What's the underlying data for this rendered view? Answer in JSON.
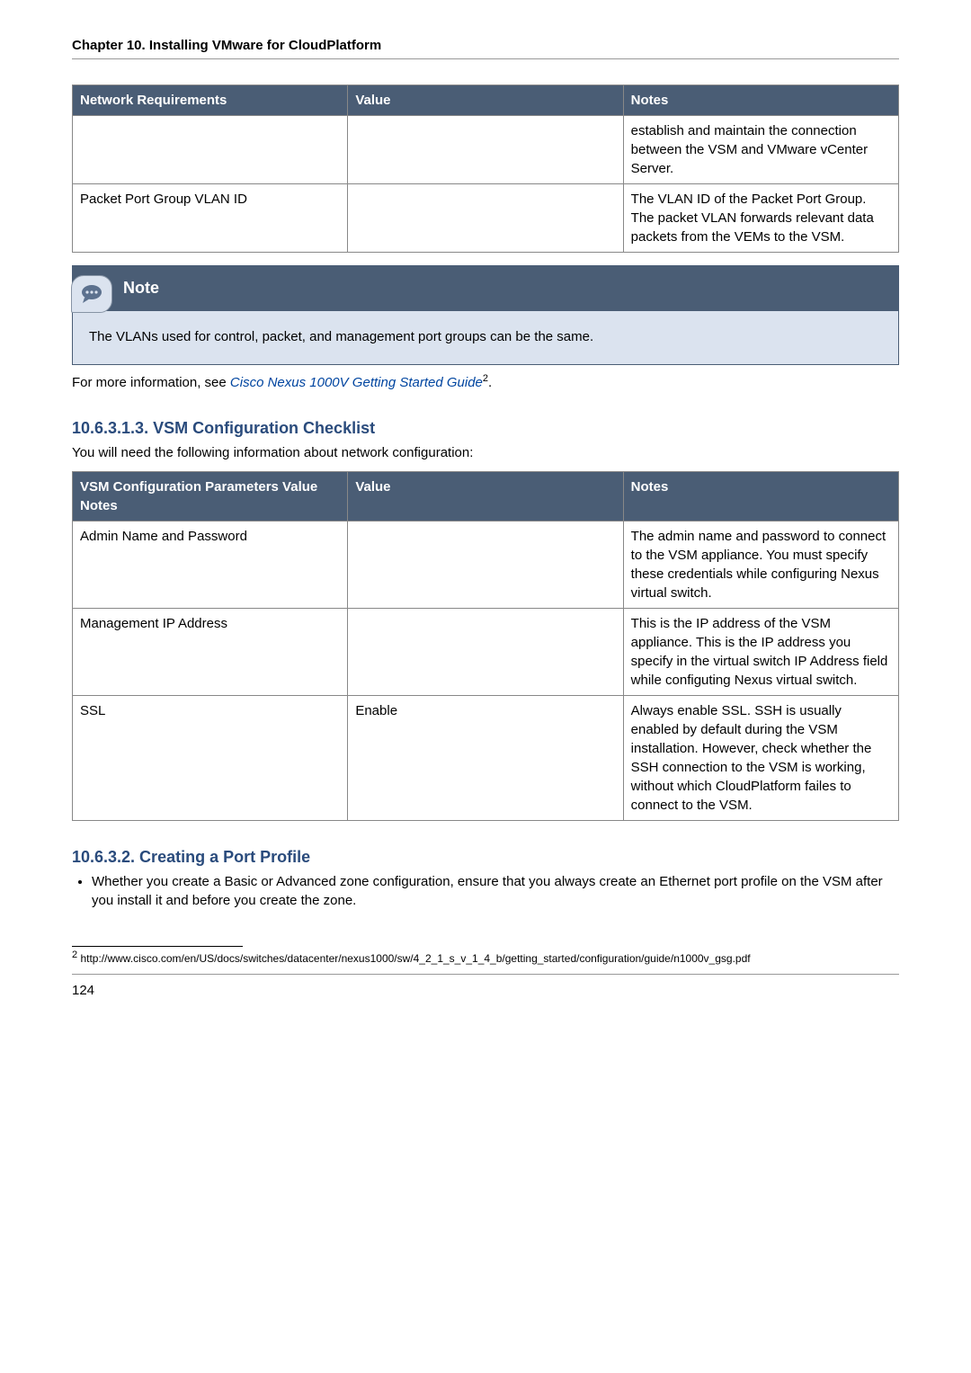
{
  "chapterHeader": "Chapter 10. Installing VMware for CloudPlatform",
  "table1": {
    "headers": [
      "Network Requirements",
      "Value",
      "Notes"
    ],
    "rows": [
      {
        "c0": "",
        "c1": "",
        "c2": "establish and maintain the connection between the VSM and VMware vCenter Server."
      },
      {
        "c0": "Packet Port Group VLAN ID",
        "c1": "",
        "c2": "The VLAN ID of the Packet Port Group. The packet VLAN forwards relevant data packets from the VEMs to the VSM."
      }
    ]
  },
  "note": {
    "title": "Note",
    "body": "The VLANs used for control, packet, and management port groups can be the same."
  },
  "moreInfoPrefix": "For more information, see ",
  "moreInfoLink": "Cisco Nexus 1000V Getting Started Guide",
  "moreInfoSup": "2",
  "moreInfoSuffix": ".",
  "section1": {
    "heading": "10.6.3.1.3. VSM Configuration Checklist",
    "intro": "You will need the following information about network configuration:"
  },
  "table2": {
    "headers": [
      "VSM Configuration Parameters Value Notes",
      "Value",
      "Notes"
    ],
    "rows": [
      {
        "c0": "Admin Name and Password",
        "c1": "",
        "c2": "The admin name and password to connect to the VSM appliance. You must specify these credentials while configuring Nexus virtual switch."
      },
      {
        "c0": "Management IP Address",
        "c1": "",
        "c2": "This is the IP address of the VSM appliance. This is the IP address you specify in the virtual switch IP Address field while configuting Nexus virtual switch."
      },
      {
        "c0": "SSL",
        "c1": "Enable",
        "c2": "Always enable SSL. SSH is usually enabled by default during the VSM installation. However, check whether the SSH connection to the VSM is working, without which CloudPlatform failes to connect to the VSM."
      }
    ]
  },
  "section2": {
    "heading": "10.6.3.2. Creating a Port Profile",
    "bullet": "Whether you create a Basic or Advanced zone configuration, ensure that you always create an Ethernet port profile on the VSM after you install it and before you create the zone."
  },
  "footnote": {
    "marker": "2",
    "text": " http://www.cisco.com/en/US/docs/switches/datacenter/nexus1000/sw/4_2_1_s_v_1_4_b/getting_started/configuration/guide/n1000v_gsg.pdf"
  },
  "pageNumber": "124"
}
